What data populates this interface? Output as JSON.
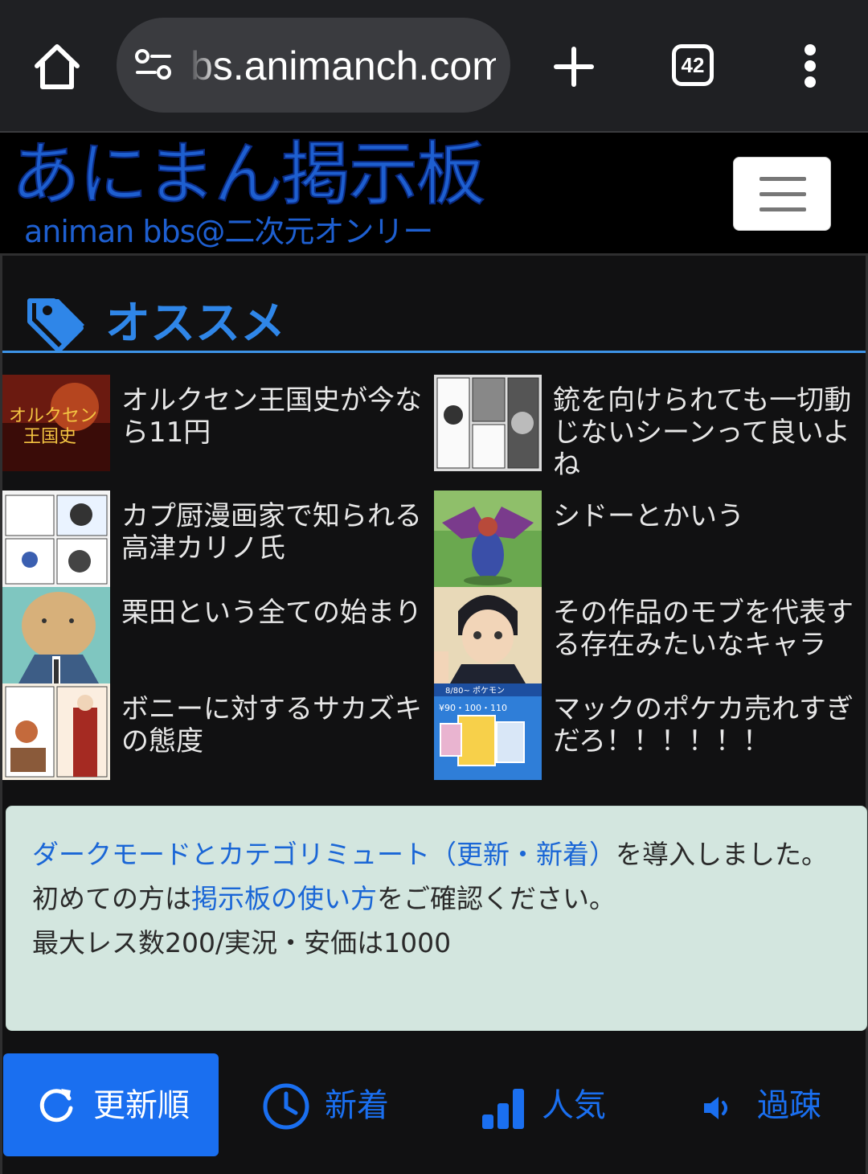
{
  "browser": {
    "url": "bs.animanch.com",
    "tab_count": "42"
  },
  "site": {
    "logo_main": "あにまん掲示板",
    "logo_sub": "animan bbs@二次元オンリー"
  },
  "recommend": {
    "title": "オススメ",
    "items": [
      {
        "title": "オルクセン王国史が今なら11円"
      },
      {
        "title": "銃を向けられても一切動じないシーンって良いよね"
      },
      {
        "title": "カプ厨漫画家で知られる高津カリノ氏"
      },
      {
        "title": "シドーとかいう"
      },
      {
        "title": "栗田という全ての始まり"
      },
      {
        "title": "その作品のモブを代表する存在みたいなキャラ"
      },
      {
        "title": "ボニーに対するサカズキの態度"
      },
      {
        "title": "マックのポケカ売れすぎだろ！！！！！！"
      }
    ]
  },
  "notice": {
    "line1_link": "ダークモードとカテゴリミュート（更新・新着）",
    "line1_rest": "を導入しました。",
    "line2_pre": "初めての方は",
    "line2_link": "掲示板の使い方",
    "line2_post": "をご確認ください。",
    "line3": "最大レス数200/実況・安価は1000"
  },
  "tabs": {
    "update": "更新順",
    "new": "新着",
    "popular": "人気",
    "past": "過疎"
  },
  "colors": {
    "accent": "#1a6ff0",
    "logo": "#1e5fd0",
    "notice_bg": "#d3e6df"
  }
}
